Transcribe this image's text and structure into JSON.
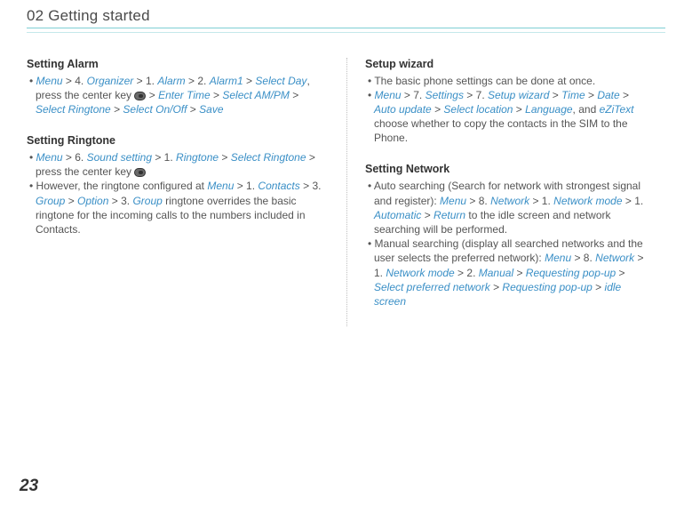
{
  "header": {
    "title": "02 Getting started"
  },
  "page_number": "23",
  "left_column": {
    "section1": {
      "heading": "Setting Alarm",
      "item1": {
        "parts": [
          {
            "type": "link",
            "text": "Menu"
          },
          {
            "type": "sep",
            "text": " > 4. "
          },
          {
            "type": "link",
            "text": "Organizer"
          },
          {
            "type": "sep",
            "text": " > 1. "
          },
          {
            "type": "link",
            "text": "Alarm"
          },
          {
            "type": "sep",
            "text": " > 2. "
          },
          {
            "type": "link",
            "text": "Alarm1"
          },
          {
            "type": "sep",
            "text": " > "
          },
          {
            "type": "link",
            "text": "Select Day"
          },
          {
            "type": "plain",
            "text": ", press the center key "
          },
          {
            "type": "icon",
            "text": ""
          },
          {
            "type": "sep",
            "text": " > "
          },
          {
            "type": "link",
            "text": "Enter Time"
          },
          {
            "type": "sep",
            "text": " > "
          },
          {
            "type": "link",
            "text": "Select AM/PM"
          },
          {
            "type": "sep",
            "text": " > "
          },
          {
            "type": "link",
            "text": "Select Ringtone"
          },
          {
            "type": "sep",
            "text": " > "
          },
          {
            "type": "link",
            "text": "Select On/Off"
          },
          {
            "type": "sep",
            "text": " > "
          },
          {
            "type": "link",
            "text": "Save"
          }
        ]
      }
    },
    "section2": {
      "heading": "Setting Ringtone",
      "item1": {
        "parts": [
          {
            "type": "link",
            "text": "Menu"
          },
          {
            "type": "sep",
            "text": " > 6. "
          },
          {
            "type": "link",
            "text": "Sound setting"
          },
          {
            "type": "sep",
            "text": " > 1. "
          },
          {
            "type": "link",
            "text": "Ringtone"
          },
          {
            "type": "sep",
            "text": " > "
          },
          {
            "type": "link",
            "text": "Select Ringtone"
          },
          {
            "type": "plain",
            "text": " > press the center key "
          },
          {
            "type": "icon",
            "text": ""
          }
        ]
      },
      "item2": {
        "parts": [
          {
            "type": "plain",
            "text": "However, the ringtone configured at "
          },
          {
            "type": "link",
            "text": "Menu"
          },
          {
            "type": "sep",
            "text": " > 1. "
          },
          {
            "type": "link",
            "text": "Contacts"
          },
          {
            "type": "sep",
            "text": " > 3. "
          },
          {
            "type": "link",
            "text": "Group"
          },
          {
            "type": "sep",
            "text": " > "
          },
          {
            "type": "link",
            "text": "Option"
          },
          {
            "type": "sep",
            "text": " > 3. "
          },
          {
            "type": "link",
            "text": "Group"
          },
          {
            "type": "plain",
            "text": " ringtone overrides the basic ringtone for the incoming calls to the numbers included in Contacts."
          }
        ]
      }
    }
  },
  "right_column": {
    "section1": {
      "heading": "Setup wizard",
      "item1": {
        "parts": [
          {
            "type": "plain",
            "text": "The basic phone settings can be done at once."
          }
        ]
      },
      "item2": {
        "parts": [
          {
            "type": "link",
            "text": "Menu"
          },
          {
            "type": "sep",
            "text": " > 7. "
          },
          {
            "type": "link",
            "text": "Settings"
          },
          {
            "type": "sep",
            "text": " > 7. "
          },
          {
            "type": "link",
            "text": "Setup wizard"
          },
          {
            "type": "sep",
            "text": " > "
          },
          {
            "type": "link",
            "text": "Time"
          },
          {
            "type": "sep",
            "text": " > "
          },
          {
            "type": "link",
            "text": "Date"
          },
          {
            "type": "sep",
            "text": " > "
          },
          {
            "type": "link",
            "text": "Auto update"
          },
          {
            "type": "sep",
            "text": " > "
          },
          {
            "type": "link",
            "text": "Select location"
          },
          {
            "type": "sep",
            "text": " > "
          },
          {
            "type": "link",
            "text": "Language"
          },
          {
            "type": "plain",
            "text": ", and "
          },
          {
            "type": "link",
            "text": "eZiText"
          },
          {
            "type": "plain",
            "text": " choose whether to copy the contacts in the SIM to the Phone."
          }
        ]
      }
    },
    "section2": {
      "heading": "Setting Network",
      "item1": {
        "parts": [
          {
            "type": "plain",
            "text": "Auto searching (Search for network with strongest signal and register): "
          },
          {
            "type": "link",
            "text": "Menu"
          },
          {
            "type": "sep",
            "text": " > 8. "
          },
          {
            "type": "link",
            "text": "Network"
          },
          {
            "type": "sep",
            "text": " > 1. "
          },
          {
            "type": "link",
            "text": "Network mode"
          },
          {
            "type": "sep",
            "text": " > 1. "
          },
          {
            "type": "link",
            "text": "Automatic"
          },
          {
            "type": "sep",
            "text": " > "
          },
          {
            "type": "link",
            "text": "Return"
          },
          {
            "type": "plain",
            "text": " to the idle screen and network searching will be performed."
          }
        ]
      },
      "item2": {
        "parts": [
          {
            "type": "plain",
            "text": "Manual searching (display all searched networks and the user selects the preferred network): "
          },
          {
            "type": "link",
            "text": "Menu"
          },
          {
            "type": "sep",
            "text": " > 8. "
          },
          {
            "type": "link",
            "text": "Network"
          },
          {
            "type": "sep",
            "text": " > 1. "
          },
          {
            "type": "link",
            "text": "Network mode"
          },
          {
            "type": "sep",
            "text": " > 2. "
          },
          {
            "type": "link",
            "text": "Manual"
          },
          {
            "type": "sep",
            "text": " > "
          },
          {
            "type": "link",
            "text": "Requesting pop-up"
          },
          {
            "type": "sep",
            "text": " > "
          },
          {
            "type": "link",
            "text": "Select preferred network"
          },
          {
            "type": "sep",
            "text": " > "
          },
          {
            "type": "link",
            "text": "Requesting pop-up"
          },
          {
            "type": "sep",
            "text": " > "
          },
          {
            "type": "link",
            "text": "idle screen"
          }
        ]
      }
    }
  }
}
